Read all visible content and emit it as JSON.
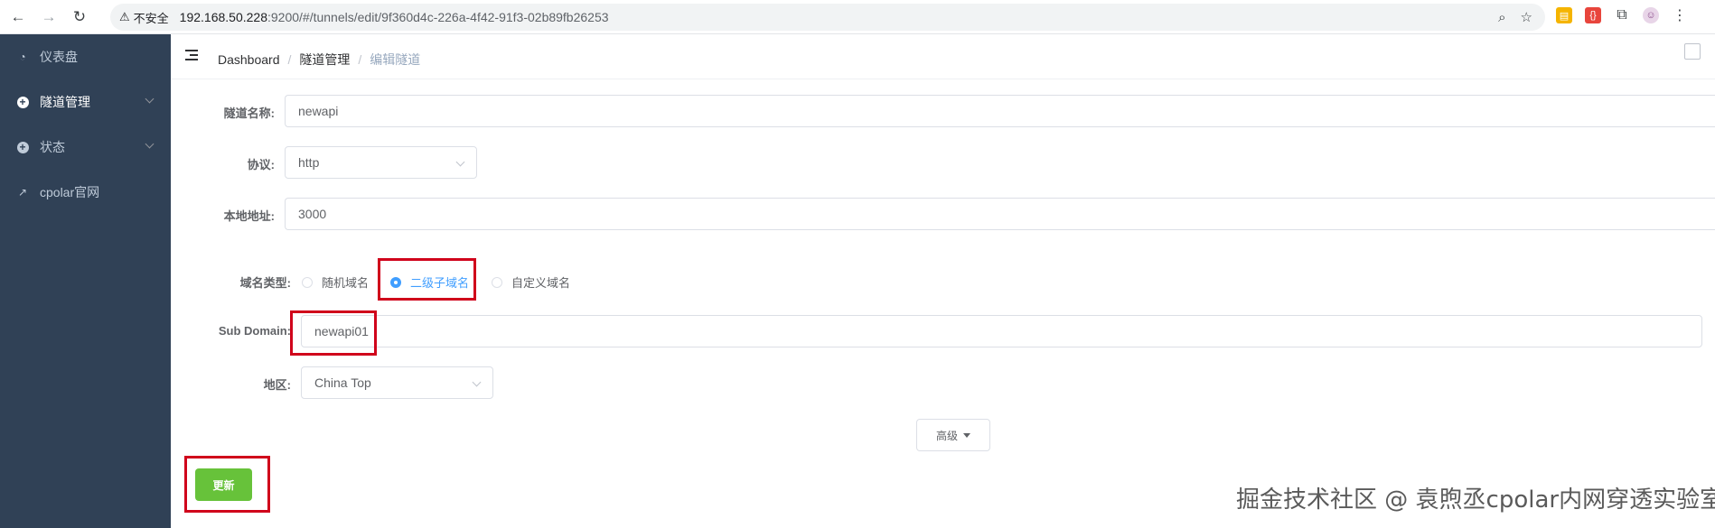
{
  "browser": {
    "security_label": "不安全",
    "url_host": "192.168.50.228",
    "url_rest": ":9200/#/tunnels/edit/9f360d4c-226a-4f42-91f3-02b89fb26253"
  },
  "sidebar": {
    "items": [
      {
        "label": "仪表盘"
      },
      {
        "label": "隧道管理"
      },
      {
        "label": "状态"
      },
      {
        "label": "cpolar官网"
      }
    ]
  },
  "breadcrumb": [
    "Dashboard",
    "隧道管理",
    "编辑隧道"
  ],
  "form": {
    "name_label": "隧道名称:",
    "name_value": "newapi",
    "protocol_label": "协议:",
    "protocol_value": "http",
    "local_label": "本地地址:",
    "local_value": "3000",
    "domain_type_label": "域名类型:",
    "domain_types": [
      "随机域名",
      "二级子域名",
      "自定义域名"
    ],
    "domain_type_selected": "二级子域名",
    "subdomain_label": "Sub Domain:",
    "subdomain_value": "newapi01",
    "region_label": "地区:",
    "region_value": "China Top",
    "advanced_label": "高级",
    "update_label": "更新"
  },
  "watermark": "掘金技术社区 @ 袁煦丞cpolar内网穿透实验室",
  "colors": {
    "sidebar_bg": "#304156",
    "accent": "#409eff",
    "update_btn": "#67c23a",
    "highlight": "#d0021b"
  }
}
